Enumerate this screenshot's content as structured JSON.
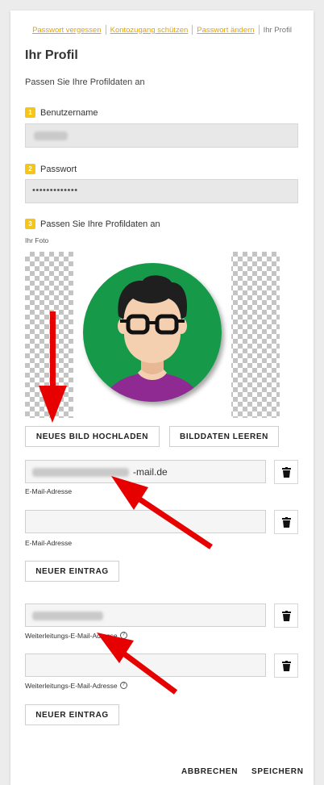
{
  "nav": {
    "links": [
      "Passwort vergessen",
      "Kontozugang schützen",
      "Passwort ändern"
    ],
    "current": "Ihr Profil"
  },
  "page": {
    "title": "Ihr Profil",
    "subtitle": "Passen Sie Ihre Profildaten an"
  },
  "steps": [
    {
      "num": "1",
      "label": "Benutzername"
    },
    {
      "num": "2",
      "label": "Passwort"
    },
    {
      "num": "3",
      "label": "Passen Sie Ihre Profildaten an"
    }
  ],
  "password_mask": "•••••••••••••",
  "photo": {
    "label": "Ihr Foto"
  },
  "buttons": {
    "upload": "NEUES BILD HOCHLADEN",
    "clear": "BILDDATEN LEEREN",
    "new_entry": "NEUER EINTRAG",
    "cancel": "ABBRECHEN",
    "save": "SPEICHERN"
  },
  "email": {
    "label": "E-Mail-Adresse",
    "value_visible": "-mail.de"
  },
  "forward": {
    "label": "Weiterleitungs-E-Mail-Adresse",
    "help": "?"
  },
  "colors": {
    "accent": "#f5c518",
    "link": "#e8a200",
    "arrow": "#e60000",
    "avatar_bg": "#169a48"
  }
}
